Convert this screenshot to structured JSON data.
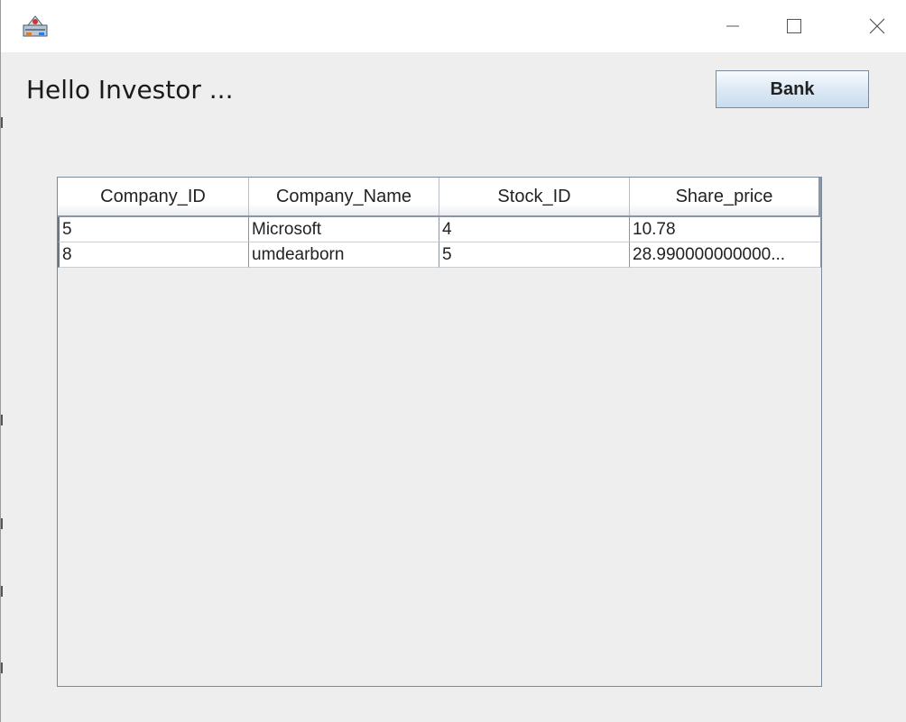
{
  "window": {
    "title": "",
    "icon": "java-app-icon",
    "controls": {
      "minimize": "minimize-icon",
      "maximize": "maximize-icon",
      "close": "close-icon"
    }
  },
  "greeting": "Hello Investor ...",
  "bank_button": "Bank",
  "table": {
    "headers": [
      "Company_ID",
      "Company_Name",
      "Stock_ID",
      "Share_price"
    ],
    "rows": [
      [
        "5",
        "Microsoft",
        "4",
        "10.78"
      ],
      [
        "8",
        "umdearborn",
        "5",
        "28.990000000000..."
      ]
    ]
  },
  "colors": {
    "window_bg": "#eeeeee",
    "titlebar_bg": "#ffffff",
    "button_gradient_top": "#f7fbff",
    "button_gradient_bottom": "#c9dced",
    "table_border": "#7a8a99"
  }
}
